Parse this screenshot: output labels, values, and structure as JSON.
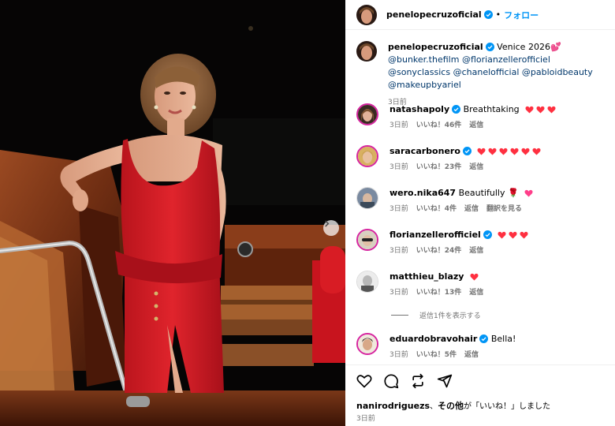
{
  "header": {
    "username": "penelopecruzoficial",
    "separator": "•",
    "follow_label": "フォロー"
  },
  "caption": {
    "username": "penelopecruzoficial",
    "text": "Venice 2026",
    "mentions": [
      "@bunker.thefilm",
      "@florianzellerofficiel",
      "@sonyclassics",
      "@chanelofficial",
      "@pabloidbeauty",
      "@makeupbyariel"
    ],
    "time": "3日前"
  },
  "comments": [
    {
      "username": "natashapoly",
      "verified": true,
      "text": "Breathtaking",
      "hearts": 3,
      "time": "3日前",
      "likes": "いいね！46件",
      "reply": "返信"
    },
    {
      "username": "saracarbonero",
      "verified": true,
      "text": "",
      "hearts": 6,
      "time": "3日前",
      "likes": "いいね！23件",
      "reply": "返信"
    },
    {
      "username": "wero.nika647",
      "verified": false,
      "text": "Beautifully 🌹",
      "hearts": 1,
      "time": "3日前",
      "likes": "いいね！4件",
      "reply": "返信",
      "translate": "翻訳を見る"
    },
    {
      "username": "florianzellerofficiel",
      "verified": true,
      "text": "",
      "hearts": 3,
      "time": "3日前",
      "likes": "いいね！24件",
      "reply": "返信"
    },
    {
      "username": "matthieu_blazy",
      "verified": false,
      "text": "",
      "hearts": 1,
      "time": "3日前",
      "likes": "いいね！13件",
      "reply": "返信"
    },
    {
      "username": "eduardobravohair",
      "verified": true,
      "text": "Bella!",
      "hearts": 0,
      "time": "3日前",
      "likes": "いいね！5件",
      "reply": "返信"
    }
  ],
  "view_replies": "返信1件を表示する",
  "footer": {
    "liked_by_user": "nanirodriguezs",
    "liked_by_connector": "、",
    "liked_by_others": "その他",
    "liked_by_suffix": "が「いいね！」しました",
    "time": "3日前"
  },
  "colors": {
    "verified": "#0095f6",
    "heart": "#ff3040",
    "link": "#00376b",
    "follow": "#0095f6",
    "muted": "#737373"
  },
  "icons": {
    "header_verified": "verified-badge-icon",
    "next": "chevron-right-icon",
    "like": "heart-outline-icon",
    "comment": "comment-bubble-icon",
    "share": "repost-icon",
    "send": "paper-plane-icon"
  }
}
